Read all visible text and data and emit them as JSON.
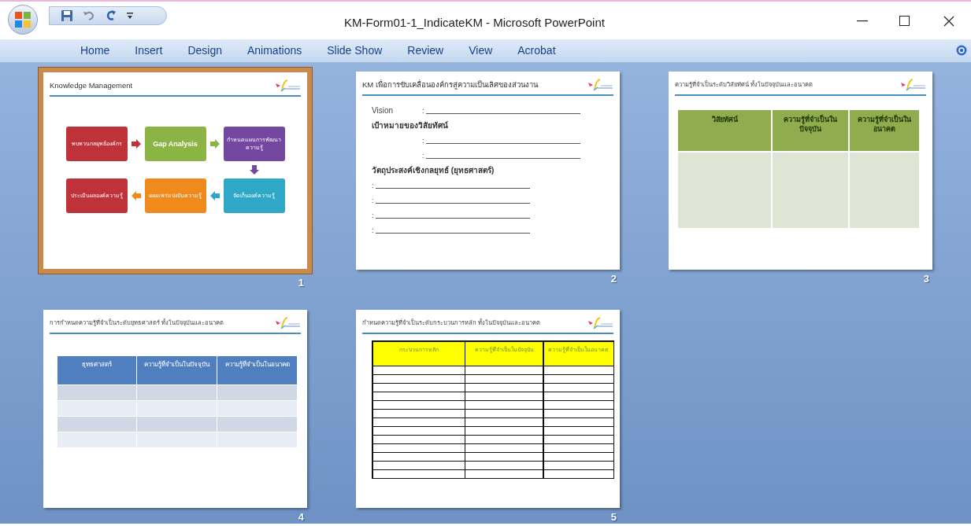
{
  "window": {
    "title": "KM-Form01-1_IndicateKM - Microsoft PowerPoint"
  },
  "ribbon_tabs": [
    {
      "label": "Home",
      "selected": false
    },
    {
      "label": "Insert",
      "selected": false
    },
    {
      "label": "Design",
      "selected": false
    },
    {
      "label": "Animations",
      "selected": false
    },
    {
      "label": "Slide Show",
      "selected": false
    },
    {
      "label": "Review",
      "selected": false
    },
    {
      "label": "View",
      "selected": false
    },
    {
      "label": "Acrobat",
      "selected": false
    }
  ],
  "slides": [
    {
      "number": "1",
      "selected": true,
      "kind": "diagram",
      "title": "Knowledge Management",
      "steps": [
        {
          "text": "ทบทวนกลยุทธ์องค์กร",
          "color": "#c0323a"
        },
        {
          "text": "Gap Analysis",
          "color": "#8cb444"
        },
        {
          "text": "กำหนดแผนการพัฒนาความรู้",
          "color": "#7448a0"
        },
        {
          "text": "ประเมินผลองค์ความรู้",
          "color": "#c0323a"
        },
        {
          "text": "เผยแพร่แบ่งปันความรู้",
          "color": "#f08a1c"
        },
        {
          "text": "จัดเก็บองค์ความรู้",
          "color": "#2fa8c8"
        }
      ]
    },
    {
      "number": "2",
      "selected": false,
      "kind": "form",
      "title": "KM เพื่อการขับเคลื่อนองค์กรสู่ความเป็นเลิศของส่วนงาน",
      "lines": [
        {
          "kind": "labelled",
          "label": "Vision",
          "prefix": ":"
        },
        {
          "kind": "heading",
          "label": "เป้าหมายของวิสัยทัศน์"
        },
        {
          "kind": "indented",
          "prefix": ":"
        },
        {
          "kind": "indented",
          "prefix": ":"
        },
        {
          "kind": "heading",
          "label": "วัตถุประสงค์เชิงกลยุทธ์ (ยุทธศาสตร์)"
        },
        {
          "kind": "plain",
          "prefix": ":"
        },
        {
          "kind": "plain",
          "prefix": ":"
        },
        {
          "kind": "plain",
          "prefix": ":"
        },
        {
          "kind": "plain",
          "prefix": ":"
        }
      ]
    },
    {
      "number": "3",
      "selected": false,
      "kind": "shaded_table",
      "title": "ความรู้ที่จำเป็นระดับวิสัยทัศน์ ทั้งในปัจจุบันและอนาคต",
      "columns": [
        "วิสัยทัศน์",
        "ความรู้ที่จำเป็นในปัจจุบัน",
        "ความรู้ที่จำเป็นในอนาคต"
      ],
      "rows": [
        {
          "kind": "blank"
        }
      ]
    },
    {
      "number": "4",
      "selected": false,
      "kind": "striped_table",
      "title": "การกำหนดความรู้ที่จำเป็นระดับยุทธศาสตร์ ทั้งในปัจจุบันและอนาคต",
      "columns": [
        "ยุทธศาสตร์",
        "ความรู้ที่จำเป็นในปัจจุบัน",
        "ความรู้ที่จำเป็นในอนาคต"
      ],
      "rows": [
        {
          "kind": "blank"
        },
        {
          "kind": "blank"
        },
        {
          "kind": "blank"
        },
        {
          "kind": "blank"
        }
      ]
    },
    {
      "number": "5",
      "selected": false,
      "kind": "ruled_table",
      "title": "กำหนดความรู้ที่จำเป็นระดับกระบวนการหลัก ทั้งในปัจจุบันและอนาคต",
      "columns": [
        "กระบวนการหลัก",
        "ความรู้ที่จำเป็นในปัจจุบัน",
        "ความรู้ที่จำเป็นในอนาคต"
      ],
      "rows": [
        {
          "kind": "blank"
        },
        {
          "kind": "blank"
        },
        {
          "kind": "blank"
        },
        {
          "kind": "blank"
        },
        {
          "kind": "blank"
        },
        {
          "kind": "blank"
        },
        {
          "kind": "blank"
        },
        {
          "kind": "blank"
        },
        {
          "kind": "blank"
        },
        {
          "kind": "blank"
        },
        {
          "kind": "blank"
        },
        {
          "kind": "blank"
        },
        {
          "kind": "blank"
        }
      ]
    }
  ]
}
